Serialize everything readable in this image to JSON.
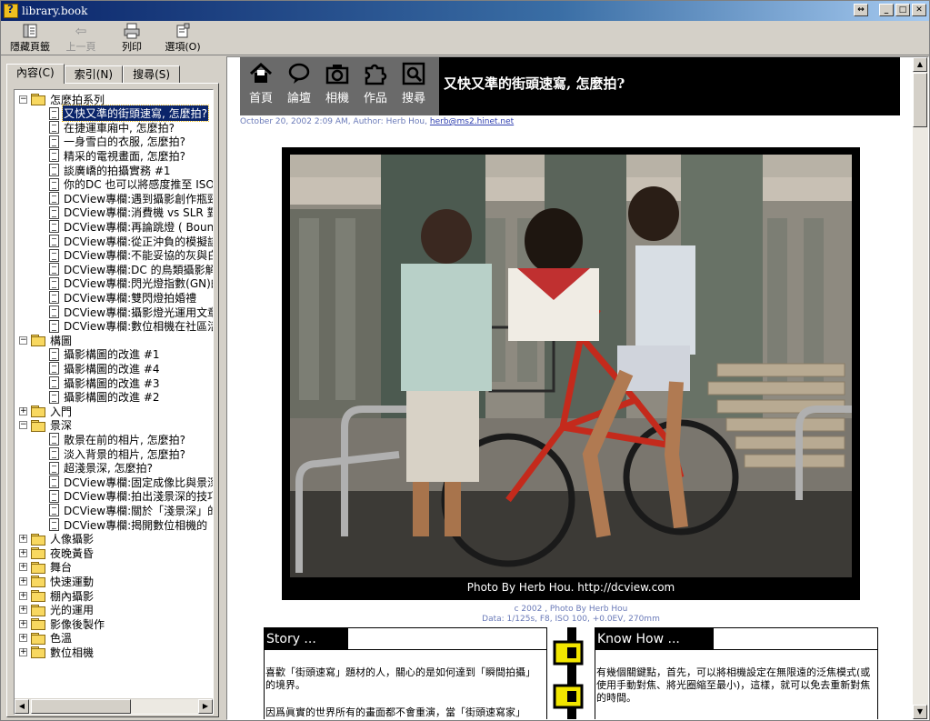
{
  "window": {
    "title": "library.book"
  },
  "toolbar": {
    "buttons": [
      {
        "label": "隱藏頁籤",
        "icon": "hide-tabs-icon",
        "enabled": true
      },
      {
        "label": "上一頁",
        "icon": "back-arrow-icon",
        "enabled": false
      },
      {
        "label": "列印",
        "icon": "printer-icon",
        "enabled": true
      },
      {
        "label": "選項(O)",
        "icon": "options-icon",
        "enabled": true
      }
    ]
  },
  "tabs": [
    {
      "label": "內容(C)",
      "active": true
    },
    {
      "label": "索引(N)",
      "active": false
    },
    {
      "label": "搜尋(S)",
      "active": false
    }
  ],
  "tree": [
    {
      "type": "folder",
      "expanded": true,
      "label": "怎麼拍系列"
    },
    {
      "type": "page",
      "label": "又快又準的街頭速寫, 怎麼拍?",
      "selected": true
    },
    {
      "type": "page",
      "label": "在捷運車廂中, 怎麼拍?"
    },
    {
      "type": "page",
      "label": "一身雪白的衣服, 怎麼拍?"
    },
    {
      "type": "page",
      "label": "精采的電視畫面, 怎麼拍?"
    },
    {
      "type": "page",
      "label": "談廣嶠的拍攝實務 #1"
    },
    {
      "type": "page",
      "label": "你的DC 也可以將感度推至 ISO"
    },
    {
      "type": "page",
      "label": "DCView專欄:遇到攝影創作瓶頸"
    },
    {
      "type": "page",
      "label": "DCView專欄:消費機 vs SLR 對最"
    },
    {
      "type": "page",
      "label": "DCView專欄:再論跳燈 ( Bounc"
    },
    {
      "type": "page",
      "label": "DCView專欄:從正沖負的模擬談"
    },
    {
      "type": "page",
      "label": "DCView專欄:不能妥協的灰與白"
    },
    {
      "type": "page",
      "label": "DCView專欄:DC 的鳥類攝影解決"
    },
    {
      "type": "page",
      "label": "DCView專欄:閃光燈指數(GN)的"
    },
    {
      "type": "page",
      "label": "DCView專欄:雙閃燈拍婚禮"
    },
    {
      "type": "page",
      "label": "DCView專欄:攝影燈光運用文章"
    },
    {
      "type": "page",
      "label": "DCView專欄:數位相機在社區活"
    },
    {
      "type": "folder",
      "expanded": true,
      "label": "構圖"
    },
    {
      "type": "page",
      "label": "攝影構圖的改進 #1"
    },
    {
      "type": "page",
      "label": "攝影構圖的改進 #4"
    },
    {
      "type": "page",
      "label": "攝影構圖的改進 #3"
    },
    {
      "type": "page",
      "label": "攝影構圖的改進 #2"
    },
    {
      "type": "folder",
      "expanded": false,
      "label": "入門"
    },
    {
      "type": "folder",
      "expanded": true,
      "label": "景深"
    },
    {
      "type": "page",
      "label": "散景在前的相片, 怎麼拍?"
    },
    {
      "type": "page",
      "label": "淡入背景的相片, 怎麼拍?"
    },
    {
      "type": "page",
      "label": "超淺景深, 怎麼拍?"
    },
    {
      "type": "page",
      "label": "DCView專欄:固定成像比與景深"
    },
    {
      "type": "page",
      "label": "DCView專欄:拍出淺景深的技巧"
    },
    {
      "type": "page",
      "label": "DCView專欄:關於「淺景深」的"
    },
    {
      "type": "page",
      "label": "DCView專欄:揭開數位相機的「"
    },
    {
      "type": "folder",
      "expanded": false,
      "label": "人像攝影"
    },
    {
      "type": "folder",
      "expanded": false,
      "label": "夜晚黃昏"
    },
    {
      "type": "folder",
      "expanded": false,
      "label": "舞台"
    },
    {
      "type": "folder",
      "expanded": false,
      "label": "快速運動"
    },
    {
      "type": "folder",
      "expanded": false,
      "label": "棚內攝影"
    },
    {
      "type": "folder",
      "expanded": false,
      "label": "光的運用"
    },
    {
      "type": "folder",
      "expanded": false,
      "label": "影像後製作"
    },
    {
      "type": "folder",
      "expanded": false,
      "label": "色溫"
    },
    {
      "type": "folder",
      "expanded": false,
      "label": "數位相機"
    }
  ],
  "article": {
    "nav": [
      {
        "label": "首頁",
        "icon": "home-icon"
      },
      {
        "label": "論壇",
        "icon": "speech-bubble-icon"
      },
      {
        "label": "相機",
        "icon": "camera-icon"
      },
      {
        "label": "作品",
        "icon": "puzzle-icon"
      },
      {
        "label": "搜尋",
        "icon": "magnifier-icon"
      }
    ],
    "title": "又快又準的街頭速寫, 怎麼拍?",
    "meta": "October 20, 2002 2:09 AM, Author: Herb Hou,",
    "email": "herb@ms2.hinet.net",
    "photo_caption": "Photo By Herb Hou. http://dcview.com",
    "credit_line1": "c 2002 , Photo By Herb Hou",
    "credit_line2": "Data: 1/125s, F8, ISO 100, +0.0EV, 270mm",
    "story": {
      "heading": "Story ...",
      "text1": "喜歡「街頭速寫」題材的人，關心的是如何達到「瞬間拍攝」的境界。",
      "text2": "因爲眞實的世界所有的畫面都不會重演，當「街頭速寫家」"
    },
    "knowhow": {
      "heading": "Know How ...",
      "text1": "有幾個關鍵點，首先，可以將相機設定在無限遠的泛焦模式(或使用手動對焦、將光圈縮至最小)，這樣，就可以免去重新對焦的時間。"
    }
  },
  "colors": {
    "titlebar_start": "#0a246a",
    "titlebar_end": "#a6caf0",
    "selection": "#0a246a",
    "meta_text": "#6a7ab8",
    "chain_yellow": "#f2e600"
  }
}
